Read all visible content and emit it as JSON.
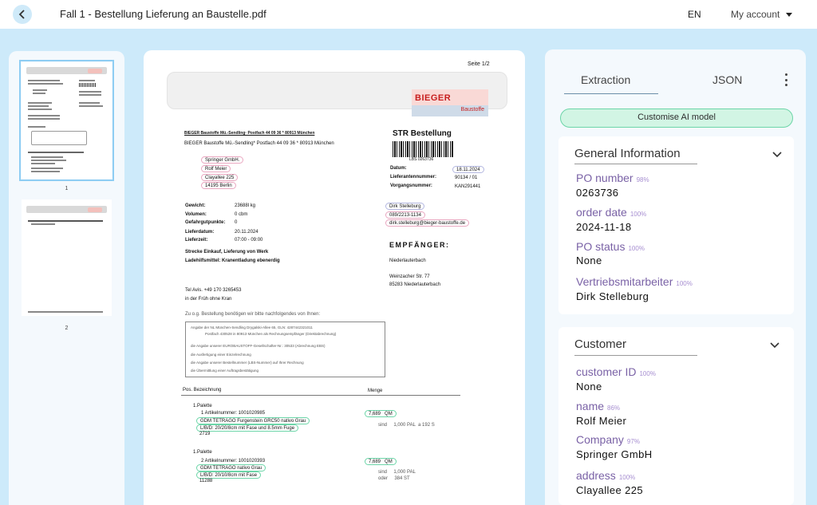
{
  "header": {
    "title": "Fall 1 - Bestellung Lieferung an Baustelle.pdf",
    "language": "EN",
    "account": "My account"
  },
  "thumbnails": [
    {
      "page": "1"
    },
    {
      "page": "2"
    }
  ],
  "document": {
    "page_label": "Seite 1/2",
    "logo_main": "BIEGER",
    "logo_sub": "Baustoffe",
    "sender_underlined": "BIEGER Baustoffe Mü.-Sendling· Postfach 44 09 36 * 80913 München",
    "sender_line": "BIEGER Baustoffe Mü.-Sendling* Postfach 44 09 36 * 80913 München",
    "recipient": [
      "Springer GmbH.",
      "Rolf Meier",
      "Clayallee 225",
      "14195 Berlin"
    ],
    "order_title": "STR Bestellung",
    "barcode_text": "LBS 0263736",
    "meta_labels": [
      "Datum:",
      "Lieferantennummer:",
      "Vorgangsnummer:"
    ],
    "meta_values": [
      "18.11.2024",
      "90134 / 01",
      "KAN291441"
    ],
    "weights_labels": [
      "Gewicht:",
      "Volumen:",
      "Gefahrgutpunkte:"
    ],
    "weights_values": [
      "23688l kg",
      "0 cbm",
      "0"
    ],
    "delivery_labels": [
      "Lieferdatum:",
      "Lieferzeit:"
    ],
    "delivery_values": [
      "20.11.2024",
      "07:00 - 09:00"
    ],
    "strecke": "Strecke Einkauf, Lieferung von Werk",
    "ladehilfsmittel": "Ladehilfsmittel: Kranentladung ebenerdig",
    "contact": [
      "Dirk Stelleburg",
      "089/2213-1134",
      "dirk.stelleburg@bieger-baustoffe.de"
    ],
    "empfaenger_title": "EMPFÄNGER:",
    "empfaenger": [
      "Niederlauterbach",
      "Weinzacher Str. 77",
      "85283 Niederlauterbach"
    ],
    "tel": "Tel Avis. +49 170 3265453",
    "tel2": "in der Früh ohne Kran",
    "hint": "Zu o.g. Bestellung benötigen wir bitte nachfolgendes von Ihnen:",
    "hint_items": [
      "Angabe der NL München-Sendling Drygalski-Allee 65, GLN: 4287442321011",
      "Postfach 430528 in 80913 München als Rechnungsempfänger (Direktabrechnung)",
      "die Angabe unserer EUROBAUSTOFF-Gesellschafter-Nr.: 30533 (Abrechnung EBS)",
      "die Ausfertigung einer Einzelrechnung",
      "die Angabe unserer Bestellnummer (LBS-Nummer) auf Ihrer Rechnung",
      "die Übermittlung einer Auftragsbestätigung"
    ],
    "col_pos": "Pos. Bezeichnung",
    "col_menge": "Menge",
    "items": [
      {
        "pos": "1.Palette",
        "artikel": "1 Artikelnummer: 1001020985",
        "name": "GDM TETRAGO Furgenstein GRC50 nativo Grau",
        "dims": "L/B/D: 20/20/8cm mit Fase und 8.5mm Fuge",
        "code": "2719",
        "qty": "7,689",
        "unit": "QM",
        "sind": "sind     1,000 PAL  a 192 S"
      },
      {
        "pos": "1.Palette",
        "artikel": "2 Artikelnummer: 1001020393",
        "name": "GDM TETRAGO nativo Grau",
        "dims": "L/B/D: 20/10/8cm mit Fase",
        "code": "11288",
        "qty": "7,689",
        "unit": "QM",
        "sind": "sind     1,000 PAL",
        "oder": "oder     384 ST"
      }
    ]
  },
  "panel": {
    "tabs": [
      "Extraction",
      "JSON"
    ],
    "customise_button": "Customise AI model",
    "general": {
      "title": "General Information",
      "fields": [
        {
          "label": "PO number",
          "confidence": "98%",
          "value": "0263736"
        },
        {
          "label": "order date",
          "confidence": "100%",
          "value": "2024-11-18"
        },
        {
          "label": "PO status",
          "confidence": "100%",
          "value": "None"
        },
        {
          "label": "Vertriebsmitarbeiter",
          "confidence": "100%",
          "value": "Dirk Stelleburg"
        }
      ]
    },
    "customer": {
      "title": "Customer",
      "fields": [
        {
          "label": "customer ID",
          "confidence": "100%",
          "value": "None"
        },
        {
          "label": "name",
          "confidence": "86%",
          "value": "Rolf Meier"
        },
        {
          "label": "Company",
          "confidence": "97%",
          "value": "Springer GmbH"
        },
        {
          "label": "address",
          "confidence": "100%",
          "value": "Clayallee 225"
        }
      ]
    }
  }
}
